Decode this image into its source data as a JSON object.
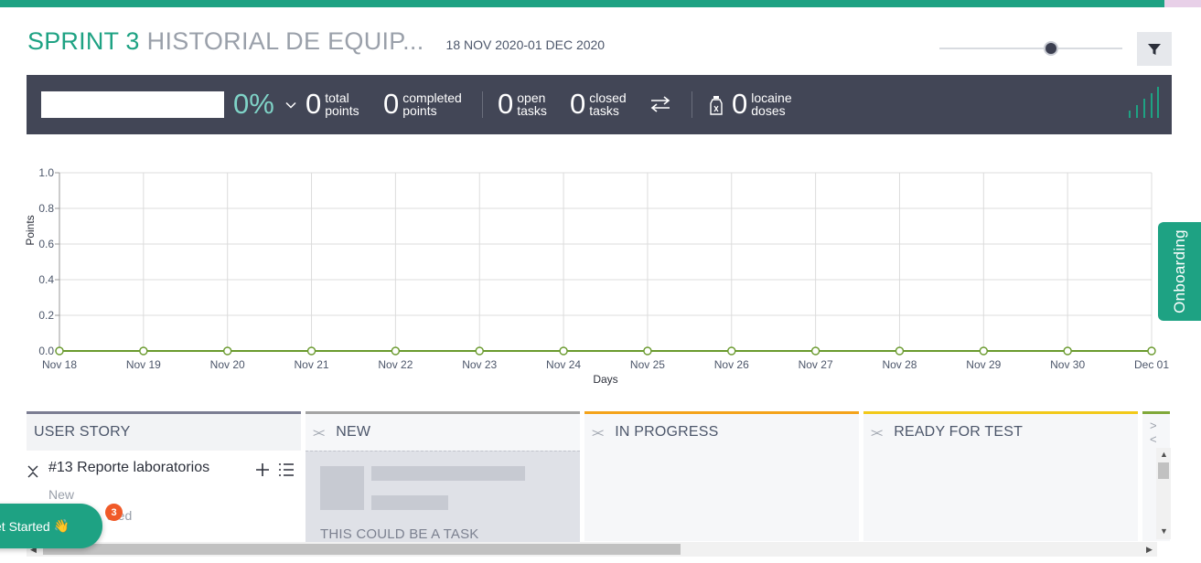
{
  "header": {
    "sprint": "SPRINT 3",
    "project": "HISTORIAL DE EQUIP...",
    "dates": "18 NOV 2020-01 DEC 2020"
  },
  "zoom": {
    "level": 0.62
  },
  "stats": {
    "input_value": "",
    "percent": "0%",
    "items": [
      {
        "value": "0",
        "label1": "total",
        "label2": "points"
      },
      {
        "value": "0",
        "label1": "completed",
        "label2": "points"
      },
      {
        "value": "0",
        "label1": "open",
        "label2": "tasks"
      },
      {
        "value": "0",
        "label1": "closed",
        "label2": "tasks"
      },
      {
        "value": "0",
        "label1": "locaine",
        "label2": "doses"
      }
    ]
  },
  "chart_data": {
    "type": "line",
    "xlabel": "Days",
    "ylabel": "Points",
    "x": [
      "Nov 18",
      "Nov 19",
      "Nov 20",
      "Nov 21",
      "Nov 22",
      "Nov 23",
      "Nov 24",
      "Nov 25",
      "Nov 26",
      "Nov 27",
      "Nov 28",
      "Nov 29",
      "Nov 30",
      "Dec 01"
    ],
    "series": [
      {
        "values": [
          0,
          0,
          0,
          0,
          0,
          0,
          0,
          0,
          0,
          0,
          0,
          0,
          0,
          0
        ],
        "color": "#6a9a2e"
      }
    ],
    "ylim": [
      0,
      1
    ],
    "yticks": [
      "0.0",
      "0.2",
      "0.4",
      "0.6",
      "0.8",
      "1.0"
    ],
    "grid": true
  },
  "board": {
    "columns": [
      {
        "title": "USER STORY"
      },
      {
        "title": "NEW"
      },
      {
        "title": "IN PROGRESS"
      },
      {
        "title": "READY FOR TEST"
      }
    ],
    "story": {
      "title": "#13 Reporte laboratorios",
      "status": "New",
      "estimate": "ated"
    },
    "placeholder_text": "THIS COULD BE A TASK"
  },
  "onboarding": {
    "label": "Onboarding"
  },
  "get_started": {
    "label": "et Started",
    "badge": "3"
  },
  "colors": {
    "accent": "#1ea283",
    "stats_bg": "#424656",
    "new": "#a4a4a4",
    "in_progress": "#f4a31a",
    "ready_for_test": "#f2c919",
    "next": "#80a839"
  }
}
